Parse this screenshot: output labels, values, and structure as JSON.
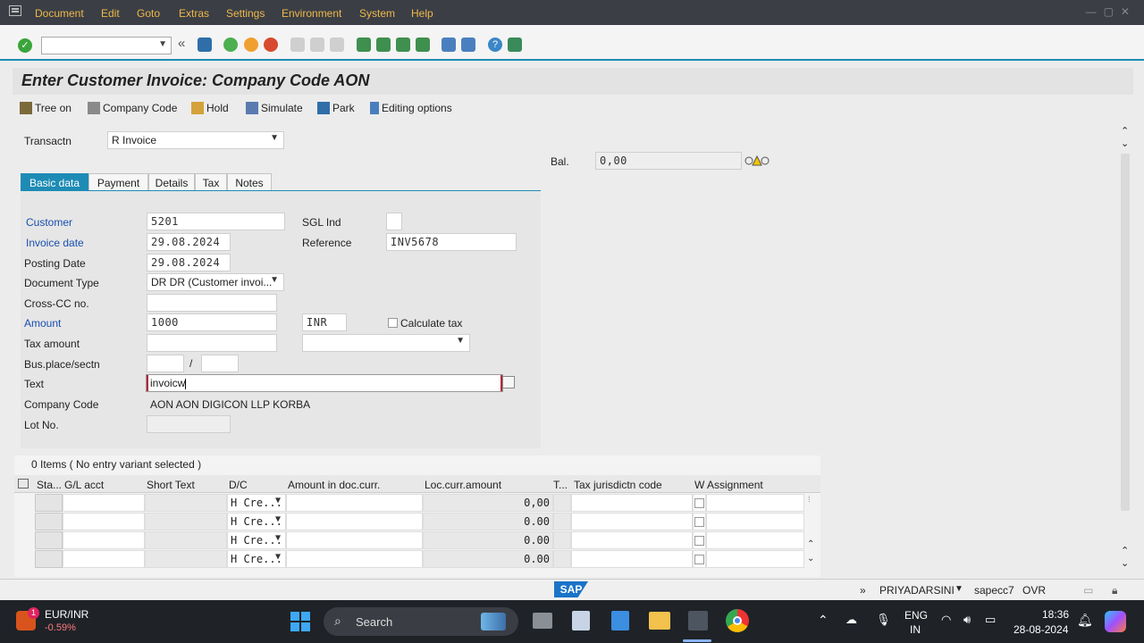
{
  "menubar": {
    "items": [
      "Document",
      "Edit",
      "Goto",
      "Extras",
      "Settings",
      "Environment",
      "System",
      "Help"
    ]
  },
  "toolbar": {
    "command_field_value": "",
    "icons": [
      "enter-icon",
      "back-nav-icon",
      "save-icon",
      "back-icon",
      "exit-icon",
      "cancel-icon",
      "print-icon",
      "find-icon",
      "find-next-icon",
      "first-page-icon",
      "prev-page-icon",
      "next-page-icon",
      "last-page-icon",
      "create-session-icon",
      "shortcut-icon",
      "help-icon",
      "layout-icon"
    ]
  },
  "title": "Enter Customer Invoice: Company Code AON",
  "app_toolbar": {
    "tree_on": "Tree on",
    "company_code": "Company Code",
    "hold": "Hold",
    "simulate": "Simulate",
    "park": "Park",
    "editing_options": "Editing options"
  },
  "transaction": {
    "label": "Transactn",
    "value": "R Invoice"
  },
  "balance": {
    "label": "Bal.",
    "value": "0,00",
    "status_color": "#f2c600"
  },
  "tabs": [
    "Basic data",
    "Payment",
    "Details",
    "Tax",
    "Notes"
  ],
  "form": {
    "customer": {
      "label": "Customer",
      "value": "5201"
    },
    "sgl_ind": {
      "label": "SGL Ind",
      "value": ""
    },
    "invoice_date": {
      "label": "Invoice date",
      "value": "29.08.2024"
    },
    "reference": {
      "label": "Reference",
      "value": "INV5678"
    },
    "posting_date": {
      "label": "Posting Date",
      "value": "29.08.2024"
    },
    "document_type": {
      "label": "Document Type",
      "value": "DR DR (Customer invoi..."
    },
    "cross_cc": {
      "label": "Cross-CC no.",
      "value": ""
    },
    "amount": {
      "label": "Amount",
      "value": "1000",
      "currency": "INR"
    },
    "calculate_tax": {
      "label": "Calculate tax",
      "checked": false
    },
    "tax_amount": {
      "label": "Tax amount",
      "value": "",
      "tax_code": ""
    },
    "bus_place": {
      "label": "Bus.place/sectn",
      "place": "",
      "separator": "/",
      "section": ""
    },
    "text": {
      "label": "Text",
      "value": "invoicw"
    },
    "company_code": {
      "label": "Company Code",
      "value": "AON AON DIGICON LLP KORBA"
    },
    "lot_no": {
      "label": "Lot No.",
      "value": ""
    }
  },
  "items_table": {
    "caption": "0 Items ( No entry variant selected )",
    "columns": [
      "Sta...",
      "G/L acct",
      "Short Text",
      "D/C",
      "Amount in doc.curr.",
      "Loc.curr.amount",
      "T...",
      "Tax jurisdictn code",
      "W",
      "Assignment"
    ],
    "rows": [
      {
        "dc": "H Cre...",
        "loc_amount": "0,00"
      },
      {
        "dc": "H Cre...",
        "loc_amount": "0.00"
      },
      {
        "dc": "H Cre...",
        "loc_amount": "0.00"
      },
      {
        "dc": "H Cre...",
        "loc_amount": "0.00"
      }
    ]
  },
  "statusbar": {
    "logo": "SAP",
    "user": "PRIYADARSINI",
    "system": "sapecc7",
    "mode": "OVR"
  },
  "taskbar": {
    "ticker": "EUR/INR",
    "ticker_change": "-0.59%",
    "ticker_badge": "1",
    "search_placeholder": "Search",
    "language_line1": "ENG",
    "language_line2": "IN",
    "time": "18:36",
    "date": "28-08-2024"
  }
}
